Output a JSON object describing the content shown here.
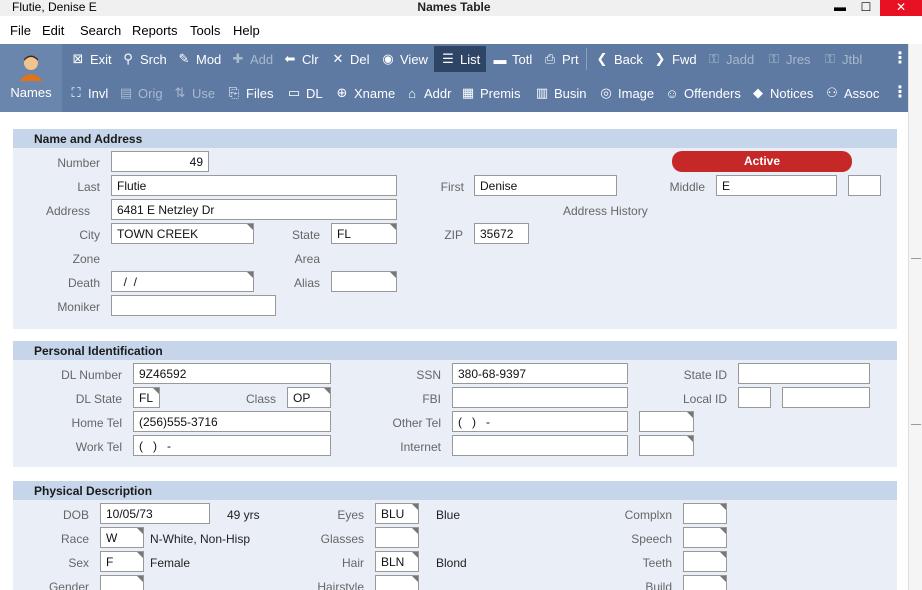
{
  "window": {
    "user": "Flutie, Denise E",
    "title": "Names Table"
  },
  "menu": [
    "File",
    "Edit",
    "Search",
    "Reports",
    "Tools",
    "Help"
  ],
  "toolbar": {
    "module_label": "Names",
    "row1": [
      {
        "label": "Exit",
        "icon": "⊠"
      },
      {
        "label": "Srch",
        "icon": "⚲"
      },
      {
        "label": "Mod",
        "icon": "✎"
      },
      {
        "label": "Add",
        "icon": "✚"
      },
      {
        "label": "Clr",
        "icon": "⬅"
      },
      {
        "label": "Del",
        "icon": "✕"
      },
      {
        "label": "View",
        "icon": "◉"
      },
      {
        "label": "List",
        "icon": "☰"
      },
      {
        "label": "Totl",
        "icon": "▬"
      },
      {
        "label": "Prt",
        "icon": "⎙"
      },
      {
        "label": "Back",
        "icon": "❮"
      },
      {
        "label": "Fwd",
        "icon": "❯"
      },
      {
        "label": "Jadd",
        "icon": "⚿"
      },
      {
        "label": "Jres",
        "icon": "⚿"
      },
      {
        "label": "Jtbl",
        "icon": "⚿"
      }
    ],
    "row2": [
      {
        "label": "Invl",
        "icon": "⛶"
      },
      {
        "label": "Orig",
        "icon": "▤"
      },
      {
        "label": "Use",
        "icon": "⇅"
      },
      {
        "label": "Files",
        "icon": "⎘"
      },
      {
        "label": "DL",
        "icon": "▭"
      },
      {
        "label": "Xname",
        "icon": "⊕"
      },
      {
        "label": "Addr",
        "icon": "⌂"
      },
      {
        "label": "Premis",
        "icon": "▦"
      },
      {
        "label": "Busin",
        "icon": "▥"
      },
      {
        "label": "Image",
        "icon": "◎"
      },
      {
        "label": "Offenders",
        "icon": "☺"
      },
      {
        "label": "Notices",
        "icon": "◆"
      },
      {
        "label": "Assoc",
        "icon": "⚇"
      }
    ]
  },
  "name_address": {
    "heading": "Name and Address",
    "number_label": "Number",
    "number": "49",
    "status": "Active",
    "last_label": "Last",
    "last": "Flutie",
    "first_label": "First",
    "first": "Denise",
    "middle_label": "Middle",
    "middle": "E",
    "address_label": "Address",
    "address": "6481 E Netzley Dr",
    "address_history": "Address History",
    "city_label": "City",
    "city": "TOWN CREEK",
    "state_label": "State",
    "state": "FL",
    "zip_label": "ZIP",
    "zip": "35672",
    "zone_label": "Zone",
    "area_label": "Area",
    "death_label": "Death",
    "death": "  /  /",
    "alias_label": "Alias",
    "moniker_label": "Moniker"
  },
  "personal_id": {
    "heading": "Personal Identification",
    "dl_number_label": "DL Number",
    "dl_number": "9Z46592",
    "ssn_label": "SSN",
    "ssn": "380-68-9397",
    "state_id_label": "State ID",
    "dl_state_label": "DL State",
    "dl_state": "FL",
    "class_label": "Class",
    "class": "OP",
    "fbi_label": "FBI",
    "local_id_label": "Local ID",
    "home_tel_label": "Home Tel",
    "home_tel": "(256)555-3716",
    "other_tel_label": "Other Tel",
    "other_tel": "(   )   -",
    "work_tel_label": "Work Tel",
    "work_tel": "(   )   -",
    "internet_label": "Internet"
  },
  "physical": {
    "heading": "Physical Description",
    "dob_label": "DOB",
    "dob": "10/05/73",
    "age": "49 yrs",
    "eyes_label": "Eyes",
    "eyes": "BLU",
    "eyes_desc": "Blue",
    "complxn_label": "Complxn",
    "race_label": "Race",
    "race": "W",
    "race_desc": "N-White, Non-Hisp",
    "glasses_label": "Glasses",
    "speech_label": "Speech",
    "sex_label": "Sex",
    "sex": "F",
    "sex_desc": "Female",
    "hair_label": "Hair",
    "hair": "BLN",
    "hair_desc": "Blond",
    "teeth_label": "Teeth",
    "gender_label": "Gender",
    "hairstyle_label": "Hairstyle",
    "build_label": "Build"
  }
}
